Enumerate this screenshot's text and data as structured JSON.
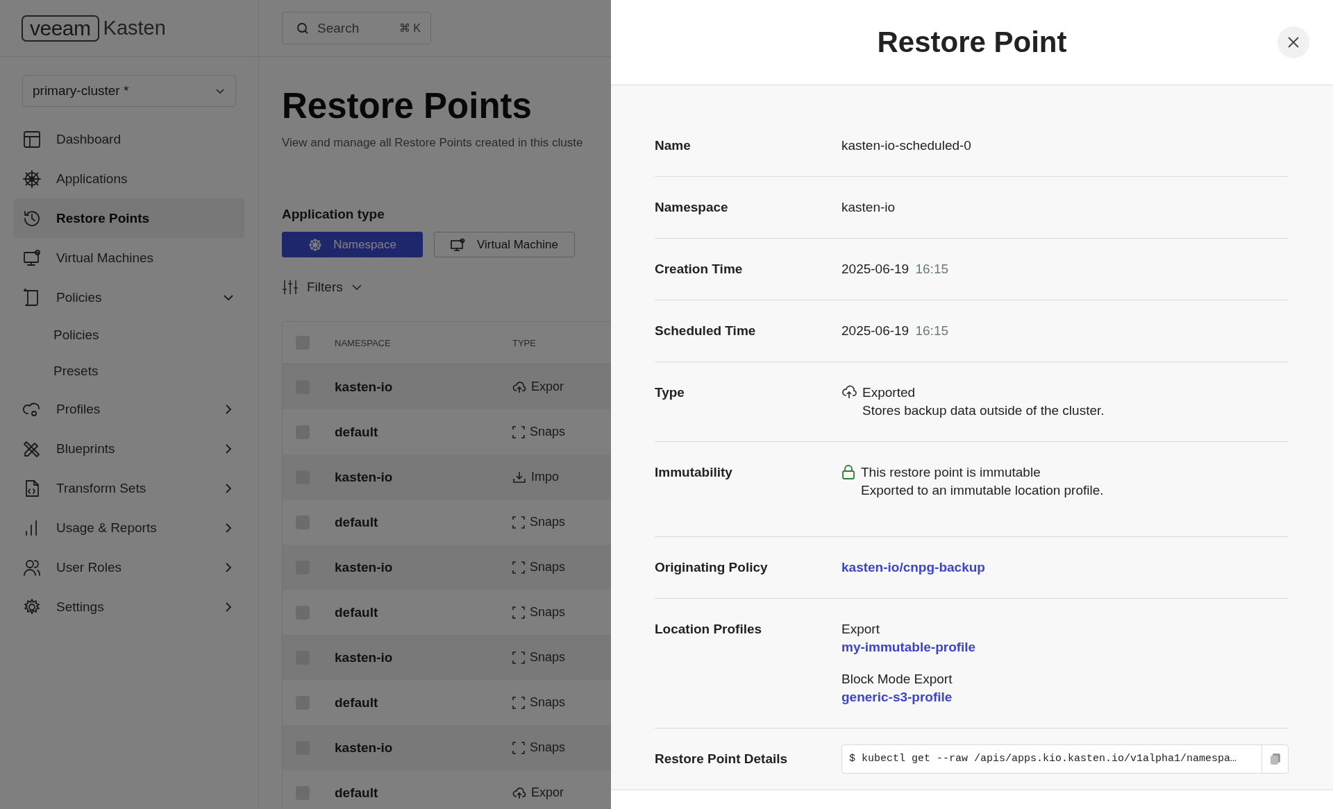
{
  "logo": {
    "brand": "veeam",
    "product": "Kasten"
  },
  "search": {
    "placeholder": "Search",
    "shortcut": "⌘ K"
  },
  "cluster_select": {
    "value": "primary-cluster *"
  },
  "sidebar": {
    "items": [
      {
        "label": "Dashboard",
        "selected": false,
        "kind": "plain"
      },
      {
        "label": "Applications",
        "selected": false,
        "kind": "plain"
      },
      {
        "label": "Restore Points",
        "selected": true,
        "kind": "plain"
      },
      {
        "label": "Virtual Machines",
        "selected": false,
        "kind": "plain"
      },
      {
        "label": "Policies",
        "selected": false,
        "kind": "group",
        "expanded": true,
        "children": [
          {
            "label": "Policies",
            "selected": false
          },
          {
            "label": "Presets",
            "selected": false
          }
        ]
      },
      {
        "label": "Profiles",
        "selected": false,
        "kind": "group",
        "expanded": false
      },
      {
        "label": "Blueprints",
        "selected": false,
        "kind": "group",
        "expanded": false
      },
      {
        "label": "Transform Sets",
        "selected": false,
        "kind": "group",
        "expanded": false
      },
      {
        "label": "Usage & Reports",
        "selected": false,
        "kind": "group",
        "expanded": false
      },
      {
        "label": "User Roles",
        "selected": false,
        "kind": "group",
        "expanded": false
      },
      {
        "label": "Settings",
        "selected": false,
        "kind": "group",
        "expanded": false
      }
    ]
  },
  "page": {
    "title": "Restore Points",
    "subtitle": "View and manage all Restore Points created in this cluste",
    "app_type_label": "Application type",
    "app_types": [
      {
        "label": "Namespace",
        "selected": true
      },
      {
        "label": "Virtual Machine",
        "selected": false
      }
    ],
    "filters": "Filters"
  },
  "table": {
    "columns": [
      "NAMESPACE",
      "TYPE"
    ],
    "select_all": {
      "checked": false
    },
    "rows": [
      {
        "namespace": "kasten-io",
        "type": "Expor",
        "kind": "export",
        "checked": false
      },
      {
        "namespace": "default",
        "type": "Snaps",
        "kind": "snapshot",
        "checked": false
      },
      {
        "namespace": "kasten-io",
        "type": "Impo",
        "kind": "import",
        "checked": false
      },
      {
        "namespace": "default",
        "type": "Snaps",
        "kind": "snapshot",
        "checked": false
      },
      {
        "namespace": "kasten-io",
        "type": "Snaps",
        "kind": "snapshot",
        "checked": false
      },
      {
        "namespace": "default",
        "type": "Snaps",
        "kind": "snapshot",
        "checked": false
      },
      {
        "namespace": "kasten-io",
        "type": "Snaps",
        "kind": "snapshot",
        "checked": false
      },
      {
        "namespace": "default",
        "type": "Snaps",
        "kind": "snapshot",
        "checked": false
      },
      {
        "namespace": "kasten-io",
        "type": "Snaps",
        "kind": "snapshot",
        "checked": false
      },
      {
        "namespace": "default",
        "type": "Expor",
        "kind": "export",
        "checked": false
      }
    ]
  },
  "drawer": {
    "title": "Restore Point",
    "fields": [
      {
        "label": "Name",
        "kind": "text",
        "value": "kasten-io-scheduled-0"
      },
      {
        "label": "Namespace",
        "kind": "text",
        "value": "kasten-io"
      },
      {
        "label": "Creation Time",
        "kind": "datetime",
        "date": "2025-06-19",
        "time": "16:15"
      },
      {
        "label": "Scheduled Time",
        "kind": "datetime",
        "date": "2025-06-19",
        "time": "16:15"
      },
      {
        "label": "Type",
        "kind": "type",
        "title": "Exported",
        "description": "Stores backup data outside of the cluster."
      },
      {
        "label": "Immutability",
        "kind": "immutability",
        "title": "This restore point is immutable",
        "description": "Exported to an immutable location profile."
      },
      {
        "label": "Originating Policy",
        "kind": "link",
        "value": "kasten-io/cnpg-backup"
      },
      {
        "label": "Location Profiles",
        "kind": "profiles",
        "profiles": [
          {
            "type": "Export",
            "name": "my-immutable-profile"
          },
          {
            "type": "Block Mode Export",
            "name": "generic-s3-profile"
          }
        ]
      },
      {
        "label": "Restore Point Details",
        "kind": "command",
        "value": "$ kubectl get --raw /apis/apps.kio.kasten.io/v1alpha1/namespa…"
      }
    ]
  }
}
